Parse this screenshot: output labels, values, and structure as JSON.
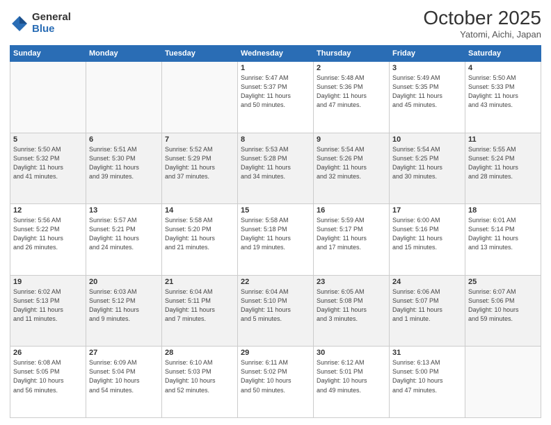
{
  "header": {
    "logo_general": "General",
    "logo_blue": "Blue",
    "month_title": "October 2025",
    "location": "Yatomi, Aichi, Japan"
  },
  "weekdays": [
    "Sunday",
    "Monday",
    "Tuesday",
    "Wednesday",
    "Thursday",
    "Friday",
    "Saturday"
  ],
  "weeks": [
    [
      {
        "day": "",
        "info": ""
      },
      {
        "day": "",
        "info": ""
      },
      {
        "day": "",
        "info": ""
      },
      {
        "day": "1",
        "info": "Sunrise: 5:47 AM\nSunset: 5:37 PM\nDaylight: 11 hours\nand 50 minutes."
      },
      {
        "day": "2",
        "info": "Sunrise: 5:48 AM\nSunset: 5:36 PM\nDaylight: 11 hours\nand 47 minutes."
      },
      {
        "day": "3",
        "info": "Sunrise: 5:49 AM\nSunset: 5:35 PM\nDaylight: 11 hours\nand 45 minutes."
      },
      {
        "day": "4",
        "info": "Sunrise: 5:50 AM\nSunset: 5:33 PM\nDaylight: 11 hours\nand 43 minutes."
      }
    ],
    [
      {
        "day": "5",
        "info": "Sunrise: 5:50 AM\nSunset: 5:32 PM\nDaylight: 11 hours\nand 41 minutes."
      },
      {
        "day": "6",
        "info": "Sunrise: 5:51 AM\nSunset: 5:30 PM\nDaylight: 11 hours\nand 39 minutes."
      },
      {
        "day": "7",
        "info": "Sunrise: 5:52 AM\nSunset: 5:29 PM\nDaylight: 11 hours\nand 37 minutes."
      },
      {
        "day": "8",
        "info": "Sunrise: 5:53 AM\nSunset: 5:28 PM\nDaylight: 11 hours\nand 34 minutes."
      },
      {
        "day": "9",
        "info": "Sunrise: 5:54 AM\nSunset: 5:26 PM\nDaylight: 11 hours\nand 32 minutes."
      },
      {
        "day": "10",
        "info": "Sunrise: 5:54 AM\nSunset: 5:25 PM\nDaylight: 11 hours\nand 30 minutes."
      },
      {
        "day": "11",
        "info": "Sunrise: 5:55 AM\nSunset: 5:24 PM\nDaylight: 11 hours\nand 28 minutes."
      }
    ],
    [
      {
        "day": "12",
        "info": "Sunrise: 5:56 AM\nSunset: 5:22 PM\nDaylight: 11 hours\nand 26 minutes."
      },
      {
        "day": "13",
        "info": "Sunrise: 5:57 AM\nSunset: 5:21 PM\nDaylight: 11 hours\nand 24 minutes."
      },
      {
        "day": "14",
        "info": "Sunrise: 5:58 AM\nSunset: 5:20 PM\nDaylight: 11 hours\nand 21 minutes."
      },
      {
        "day": "15",
        "info": "Sunrise: 5:58 AM\nSunset: 5:18 PM\nDaylight: 11 hours\nand 19 minutes."
      },
      {
        "day": "16",
        "info": "Sunrise: 5:59 AM\nSunset: 5:17 PM\nDaylight: 11 hours\nand 17 minutes."
      },
      {
        "day": "17",
        "info": "Sunrise: 6:00 AM\nSunset: 5:16 PM\nDaylight: 11 hours\nand 15 minutes."
      },
      {
        "day": "18",
        "info": "Sunrise: 6:01 AM\nSunset: 5:14 PM\nDaylight: 11 hours\nand 13 minutes."
      }
    ],
    [
      {
        "day": "19",
        "info": "Sunrise: 6:02 AM\nSunset: 5:13 PM\nDaylight: 11 hours\nand 11 minutes."
      },
      {
        "day": "20",
        "info": "Sunrise: 6:03 AM\nSunset: 5:12 PM\nDaylight: 11 hours\nand 9 minutes."
      },
      {
        "day": "21",
        "info": "Sunrise: 6:04 AM\nSunset: 5:11 PM\nDaylight: 11 hours\nand 7 minutes."
      },
      {
        "day": "22",
        "info": "Sunrise: 6:04 AM\nSunset: 5:10 PM\nDaylight: 11 hours\nand 5 minutes."
      },
      {
        "day": "23",
        "info": "Sunrise: 6:05 AM\nSunset: 5:08 PM\nDaylight: 11 hours\nand 3 minutes."
      },
      {
        "day": "24",
        "info": "Sunrise: 6:06 AM\nSunset: 5:07 PM\nDaylight: 11 hours\nand 1 minute."
      },
      {
        "day": "25",
        "info": "Sunrise: 6:07 AM\nSunset: 5:06 PM\nDaylight: 10 hours\nand 59 minutes."
      }
    ],
    [
      {
        "day": "26",
        "info": "Sunrise: 6:08 AM\nSunset: 5:05 PM\nDaylight: 10 hours\nand 56 minutes."
      },
      {
        "day": "27",
        "info": "Sunrise: 6:09 AM\nSunset: 5:04 PM\nDaylight: 10 hours\nand 54 minutes."
      },
      {
        "day": "28",
        "info": "Sunrise: 6:10 AM\nSunset: 5:03 PM\nDaylight: 10 hours\nand 52 minutes."
      },
      {
        "day": "29",
        "info": "Sunrise: 6:11 AM\nSunset: 5:02 PM\nDaylight: 10 hours\nand 50 minutes."
      },
      {
        "day": "30",
        "info": "Sunrise: 6:12 AM\nSunset: 5:01 PM\nDaylight: 10 hours\nand 49 minutes."
      },
      {
        "day": "31",
        "info": "Sunrise: 6:13 AM\nSunset: 5:00 PM\nDaylight: 10 hours\nand 47 minutes."
      },
      {
        "day": "",
        "info": ""
      }
    ]
  ]
}
